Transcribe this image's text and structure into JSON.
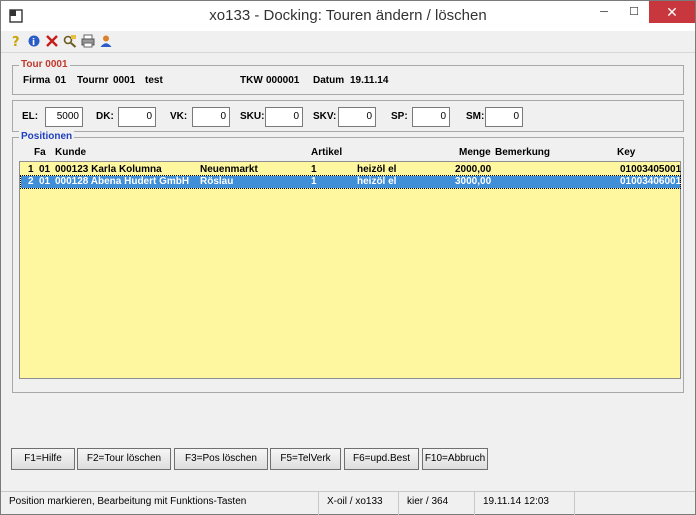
{
  "window": {
    "title": "xo133 - Docking: Touren ändern / löschen",
    "minimize": "─",
    "maximize": "☐",
    "close": "✕"
  },
  "toolbar": {
    "icons": [
      "help-icon",
      "info-icon",
      "delete-icon",
      "find-icon",
      "print-icon",
      "user-icon"
    ]
  },
  "tour": {
    "legend": "Tour 0001",
    "firma_label": "Firma",
    "firma_value": "01",
    "tournr_label": "Tournr",
    "tournr_value": "0001",
    "tour_name": "test",
    "tkw_label": "TKW",
    "tkw_value": "000001",
    "datum_label": "Datum",
    "datum_value": "19.11.14"
  },
  "counters": [
    {
      "label": "EL:",
      "value": "5000"
    },
    {
      "label": "DK:",
      "value": "0"
    },
    {
      "label": "VK:",
      "value": "0"
    },
    {
      "label": "SKU:",
      "value": "0"
    },
    {
      "label": "SKV:",
      "value": "0"
    },
    {
      "label": "SP:",
      "value": "0"
    },
    {
      "label": "SM:",
      "value": "0"
    }
  ],
  "positions": {
    "legend": "Positionen",
    "headers": {
      "fa": "Fa",
      "kunde": "Kunde",
      "artikel": "Artikel",
      "menge": "Menge",
      "bemerkung": "Bemerkung",
      "key": "Key"
    },
    "rows": [
      {
        "pos": "1",
        "fa": "01",
        "kunde": "000123 Karla Kolumna",
        "ort": "Neuenmarkt",
        "anz": "1",
        "artikel": "heizöl el",
        "menge": "2000,00",
        "key": "01003405001"
      },
      {
        "pos": "2",
        "fa": "01",
        "kunde": "000128 Abena Hudert GmbH",
        "ort": "Röslau",
        "anz": "1",
        "artikel": "heizöl el",
        "menge": "3000,00",
        "key": "01003406001"
      }
    ]
  },
  "buttons": {
    "f1": "F1=Hilfe",
    "f2": "F2=Tour löschen",
    "f3": "F3=Pos löschen",
    "f5": "F5=TelVerk",
    "f6": "F6=upd.Best",
    "f10": "F10=Abbruch"
  },
  "status": {
    "message": "Position markieren, Bearbeitung mit Funktions-Tasten",
    "module": "X-oil / xo133",
    "user": "kier / 364",
    "datetime": "19.11.14 12:03"
  },
  "colors": {
    "grid_bg": "#fff79f",
    "selection": "#3f8fd8",
    "legend_red": "#c0392b",
    "legend_blue": "#1f3fbf",
    "close": "#c7373d"
  }
}
